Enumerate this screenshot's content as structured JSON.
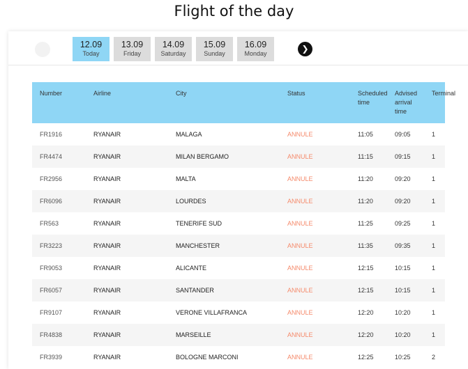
{
  "page": {
    "title": "Flight of the day"
  },
  "dates": [
    {
      "date": "12.09",
      "day": "Today",
      "active": true
    },
    {
      "date": "13.09",
      "day": "Friday",
      "active": false
    },
    {
      "date": "14.09",
      "day": "Saturday",
      "active": false
    },
    {
      "date": "15.09",
      "day": "Sunday",
      "active": false
    },
    {
      "date": "16.09",
      "day": "Monday",
      "active": false
    }
  ],
  "nav": {
    "next_icon": "chevron-right-icon",
    "prev_icon": "chevron-left-icon"
  },
  "table": {
    "headers": {
      "number": "Number",
      "airline": "Airline",
      "city": "City",
      "status": "Status",
      "scheduled": "Scheduled time",
      "advised": "Advised arrival time",
      "terminal": "Terminal"
    },
    "rows": [
      {
        "number": "FR1916",
        "airline": "RYANAIR",
        "city": "MALAGA",
        "status": "ANNULE",
        "scheduled": "11:05",
        "advised": "09:05",
        "terminal": "1"
      },
      {
        "number": "FR4474",
        "airline": "RYANAIR",
        "city": "MILAN BERGAMO",
        "status": "ANNULE",
        "scheduled": "11:15",
        "advised": "09:15",
        "terminal": "1"
      },
      {
        "number": "FR2956",
        "airline": "RYANAIR",
        "city": "MALTA",
        "status": "ANNULE",
        "scheduled": "11:20",
        "advised": "09:20",
        "terminal": "1"
      },
      {
        "number": "FR6096",
        "airline": "RYANAIR",
        "city": "LOURDES",
        "status": "ANNULE",
        "scheduled": "11:20",
        "advised": "09:20",
        "terminal": "1"
      },
      {
        "number": "FR563",
        "airline": "RYANAIR",
        "city": "TENERIFE SUD",
        "status": "ANNULE",
        "scheduled": "11:25",
        "advised": "09:25",
        "terminal": "1"
      },
      {
        "number": "FR3223",
        "airline": "RYANAIR",
        "city": "MANCHESTER",
        "status": "ANNULE",
        "scheduled": "11:35",
        "advised": "09:35",
        "terminal": "1"
      },
      {
        "number": "FR9053",
        "airline": "RYANAIR",
        "city": "ALICANTE",
        "status": "ANNULE",
        "scheduled": "12:15",
        "advised": "10:15",
        "terminal": "1"
      },
      {
        "number": "FR6057",
        "airline": "RYANAIR",
        "city": "SANTANDER",
        "status": "ANNULE",
        "scheduled": "12:15",
        "advised": "10:15",
        "terminal": "1"
      },
      {
        "number": "FR9107",
        "airline": "RYANAIR",
        "city": "VERONE VILLAFRANCA",
        "status": "ANNULE",
        "scheduled": "12:20",
        "advised": "10:20",
        "terminal": "1"
      },
      {
        "number": "FR4838",
        "airline": "RYANAIR",
        "city": "MARSEILLE",
        "status": "ANNULE",
        "scheduled": "12:20",
        "advised": "10:20",
        "terminal": "1"
      },
      {
        "number": "FR3939",
        "airline": "RYANAIR",
        "city": "BOLOGNE MARCONI",
        "status": "ANNULE",
        "scheduled": "12:25",
        "advised": "10:25",
        "terminal": "2"
      }
    ]
  },
  "colors": {
    "accent": "#8fd6f5",
    "inactive_tab": "#dcdcdc",
    "status_cancelled": "#f58a6b"
  }
}
